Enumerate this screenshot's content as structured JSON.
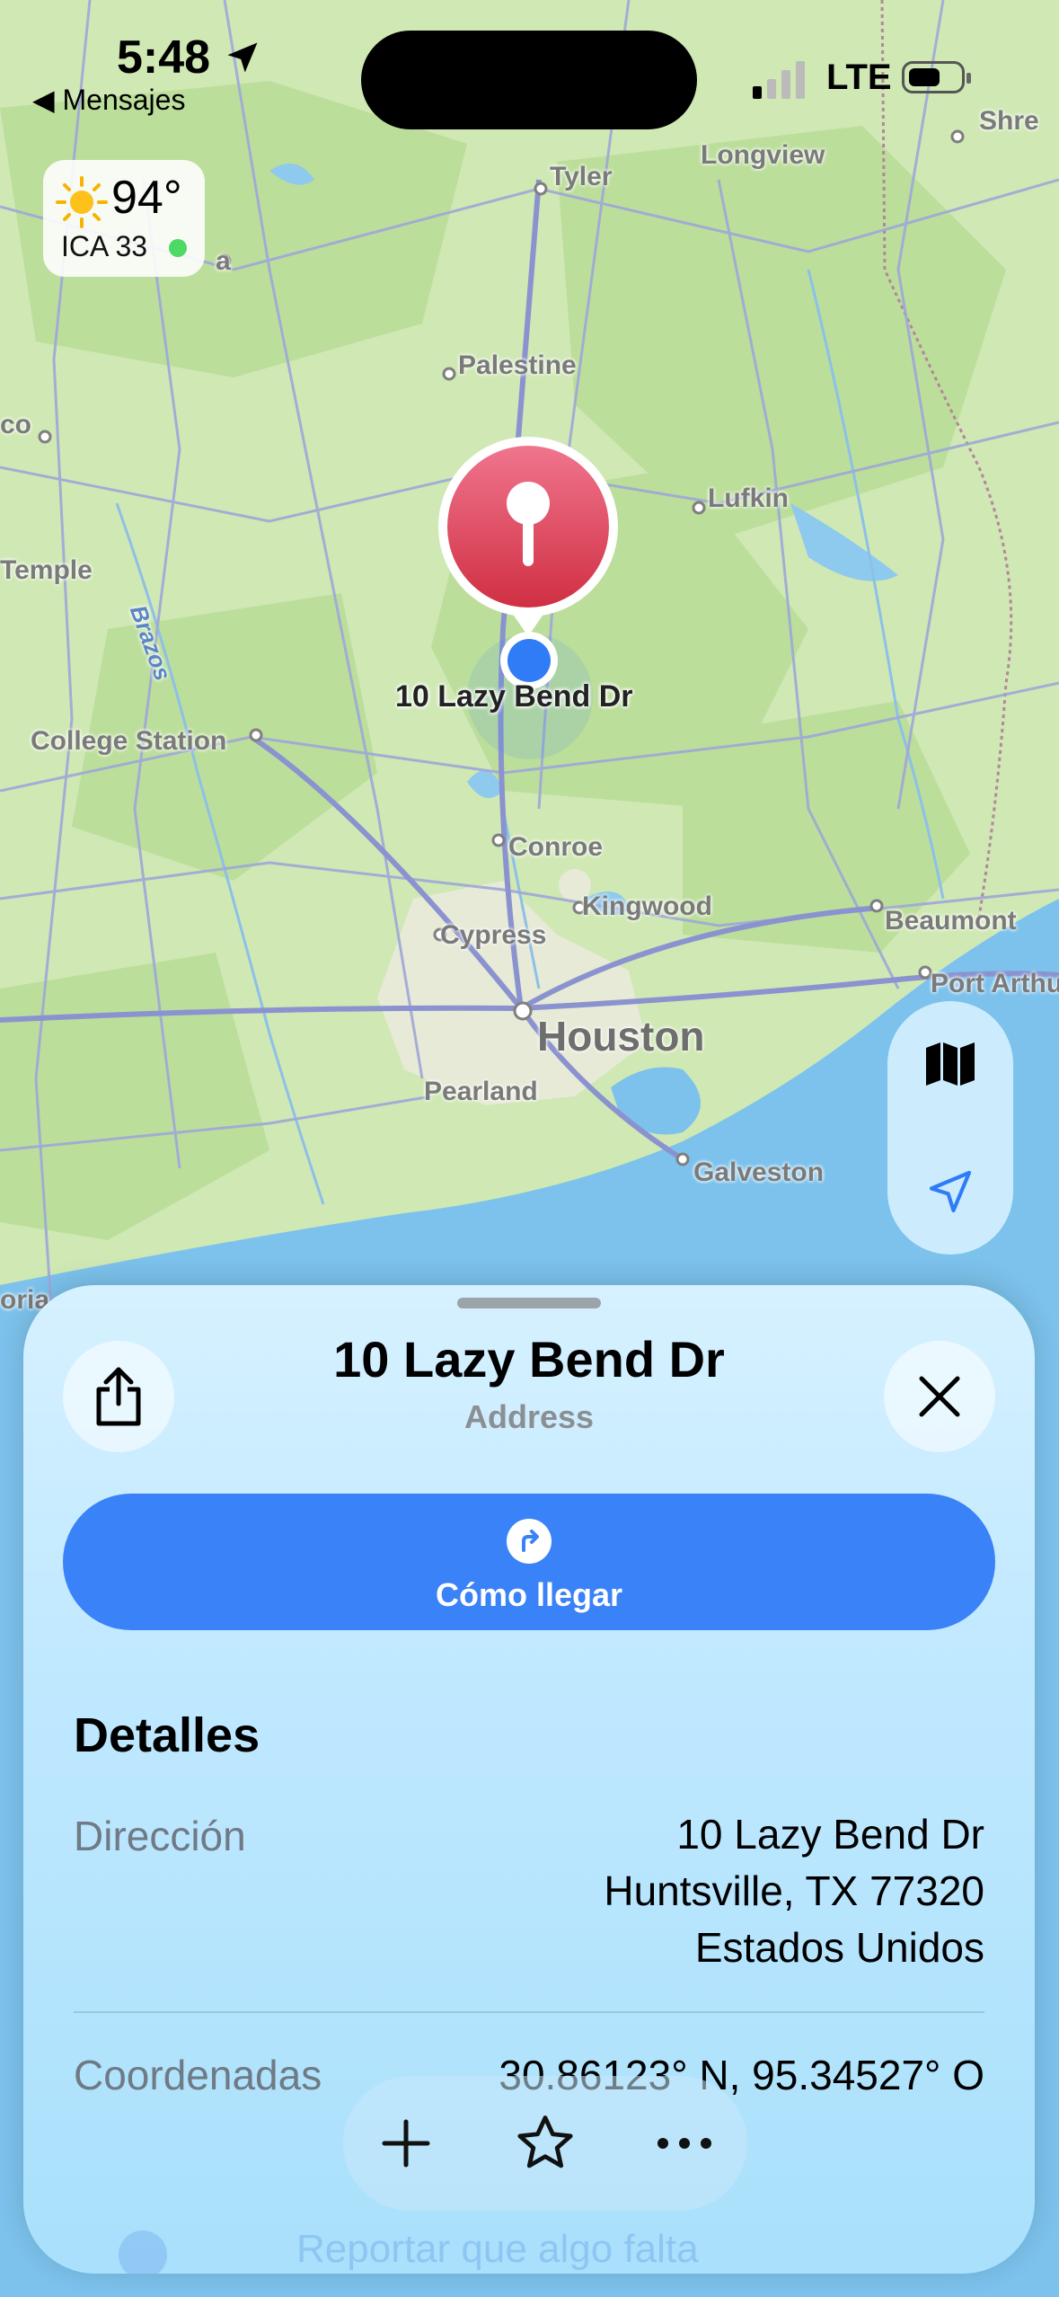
{
  "status_bar": {
    "time": "5:48",
    "back_label": "◀ Mensajes",
    "network": "LTE"
  },
  "weather": {
    "temperature": "94°",
    "aqi": "ICA 33"
  },
  "map": {
    "labels": {
      "tyler": "Tyler",
      "longview": "Longview",
      "shreveport": "Shre",
      "palestine": "Palestine",
      "lufkin": "Lufkin",
      "waco": "co",
      "temple": "Temple",
      "brazos": "Brazos",
      "college_station": "College Station",
      "conroe": "Conroe",
      "kingwood": "Kingwood",
      "cypress": "Cypress",
      "beaumont": "Beaumont",
      "port_arthur": "Port Arthu",
      "houston": "Houston",
      "pearland": "Pearland",
      "galveston": "Galveston",
      "victoria": "oria",
      "edge_a": "a"
    },
    "pin_label": "10 Lazy Bend Dr"
  },
  "sheet": {
    "title": "10 Lazy Bend Dr",
    "subtitle": "Address",
    "directions_label": "Cómo llegar",
    "details_title": "Detalles",
    "address_label": "Dirección",
    "address_lines": [
      "10 Lazy Bend Dr",
      "Huntsville, TX  77320",
      "Estados Unidos"
    ],
    "coords_label": "Coordenadas",
    "coords_value": "30.86123° N, 95.34527° O",
    "report_label": "Reportar que algo falta"
  },
  "icons": {
    "share": "share-icon",
    "close": "close-icon",
    "directions": "turn-right-icon",
    "map_mode": "map-icon",
    "location": "location-arrow-icon",
    "add": "plus-icon",
    "favorite": "star-icon",
    "more": "ellipsis-icon"
  },
  "colors": {
    "accent": "#3a82f7",
    "pin": "#d8364f",
    "user_dot": "#2f7cf6",
    "water": "#7cc2ec",
    "land": "#cde7b2"
  }
}
